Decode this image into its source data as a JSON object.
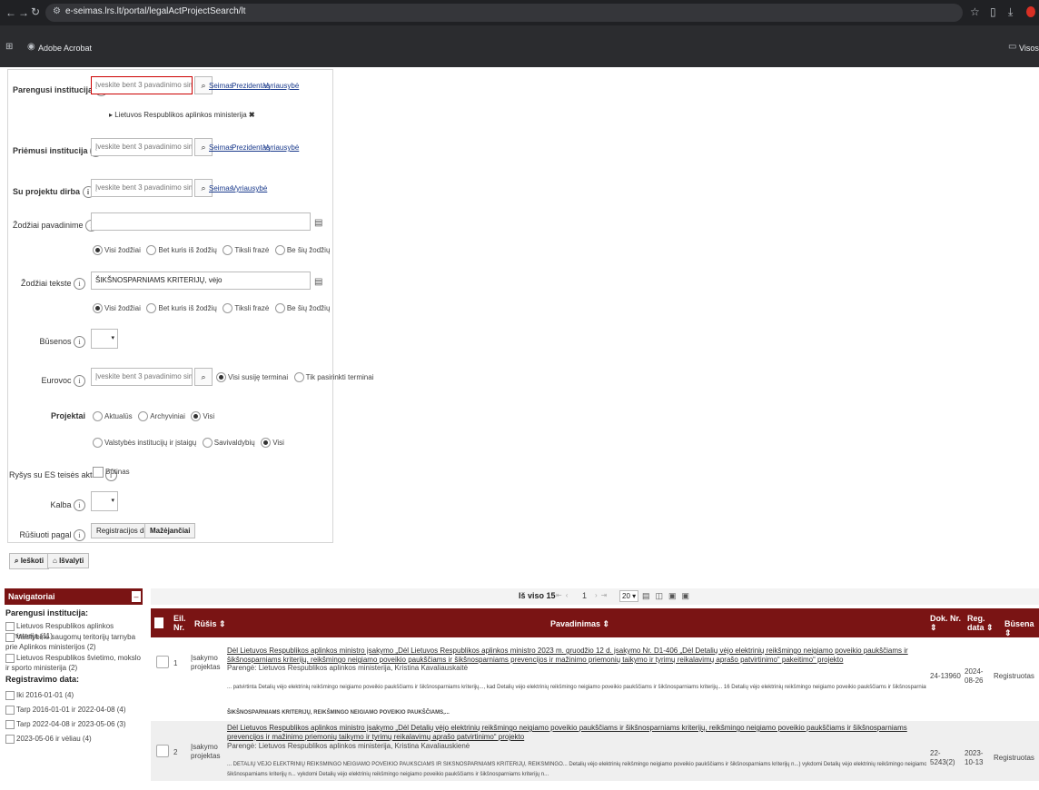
{
  "browser": {
    "url": "e-seimas.lrs.lt/portal/legalActProjectSearch/lt",
    "bookmark_acrobat": "Adobe Acrobat",
    "bookmark_other": "Visos"
  },
  "form": {
    "preparer_label": "Parengusi institucija",
    "preparer_placeholder": "Įveskite bent 3 pavadinimo simbolius",
    "preparer_selected": "Lietuvos Respublikos aplinkos ministerija",
    "links_seimas": "Seimas",
    "links_president": "Prezidentas",
    "links_government": "Vyriausybė",
    "receiver_label": "Priėmusi institucija",
    "receiver_placeholder": "Įveskite bent 3 pavadinimo simbolius",
    "worker_label": "Su projektu dirba",
    "worker_placeholder": "Įveskite bent 3 pavadinimo simbolius",
    "title_words_label": "Žodžiai pavadinime",
    "title_words_value": "",
    "text_words_label": "Žodžiai tekste",
    "text_words_value": "ŠIKŠNOSPARNIAMS KRITERIJŲ, vėjo",
    "opt_all_words": "Visi žodžiai",
    "opt_any_word": "Bet kuris iš žodžių",
    "opt_exact": "Tiksli frazė",
    "opt_without": "Be šių žodžių",
    "status_label": "Būsenos",
    "eurovoc_label": "Eurovoc",
    "eurovoc_placeholder": "Įveskite bent 3 pavadinimo simbolius",
    "eurovoc_opt_related": "Visi susiję terminai",
    "eurovoc_opt_selected": "Tik pasirinkti terminai",
    "projects_label": "Projektai",
    "opt_current": "Aktualūs",
    "opt_archive": "Archyviniai",
    "opt_all": "Visi",
    "opt_state": "Valstybės institucijų ir įstaigų",
    "opt_municipal": "Savivaldybių",
    "eu_label": "Ryšys su ES teisės aktais",
    "eu_checkbox": "Būtinas",
    "language_label": "Kalba",
    "sort_label": "Rūšiuoti pagal",
    "sort_value": "Registracijos data",
    "sort_order": "Mažėjančiai",
    "search_button": "Ieškoti",
    "clear_button": "Išvalyti"
  },
  "navigator": {
    "title": "Navigatoriai",
    "section1": "Parengusi institucija:",
    "s1_items": [
      "Lietuvos Respublikos aplinkos ministerija (11)",
      "Valstybinė saugomų teritorijų tarnyba prie Aplinkos ministerijos (2)",
      "Lietuvos Respublikos švietimo, mokslo ir sporto ministerija (2)"
    ],
    "section2": "Registravimo data:",
    "s2_items": [
      "Iki 2016-01-01 (4)",
      "Tarp 2016-01-01 ir 2022-04-08 (4)",
      "Tarp 2022-04-08 ir 2023-05-06 (3)",
      "2023-05-06 ir vėliau (4)"
    ]
  },
  "results": {
    "total_label": "Iš viso 15",
    "page": "1",
    "per_page": "20",
    "col_no": "Eil. Nr.",
    "col_type": "Rūšis ⇕",
    "col_title": "Pavadinimas ⇕",
    "col_docno": "Dok. Nr. ⇕",
    "col_regdate": "Reg. data ⇕",
    "col_status": "Būsena ⇕",
    "rows": [
      {
        "no": "1",
        "type": "Įsakymo projektas",
        "title": "Dėl Lietuvos Respublikos aplinkos ministro įsakymo „Dėl Lietuvos Respublikos aplinkos ministro 2023 m. gruodžio 12 d. įsakymo Nr. D1-406 „Dėl Detalių vėjo elektrinių reikšmingo neigiamo poveikio paukščiams ir šikšnosparniams kriterijų, reikšmingo neigiamo poveikio paukščiams ir šikšnosparniams prevencijos ir mažinimo priemonių taikymo ir tyrimų reikalavimų aprašo patvirtinimo“ pakeitimo“ projekto",
        "preparer": "Parengė: Lietuvos Respublikos aplinkos ministerija, Kristina Kavaliauskaitė",
        "snippet1": "... patvirtinta Detalių vėjo elektrinių reikšmingo neigiamo poveikio paukščiams ir šikšnosparniams kriterijų..., kad Detalių vėjo elektrinių reikšmingo neigiamo poveikio paukščiams ir šikšnosparniams kriterijų... 16 Detalių vėjo elektrinių reikšmingo neigiamo poveikio paukščiams ir šikšnosparniams kriterijų... REIKŠMINGO NEIGIAMO POVEIKIO PAUKŠČIAMS IR",
        "snippet2": "ŠIKŠNOSPARNIAMS KRITERIJŲ, REIKŠMINGO NEIGIAMO POVEIKIO PAUKŠČIAMS,...",
        "docno": "24-13960",
        "regdate": "2024-08-26",
        "status": "Registruotas"
      },
      {
        "no": "2",
        "type": "Įsakymo projektas",
        "title": "Dėl Lietuvos Respublikos aplinkos ministro įsakymo „Dėl Detalių vėjo elektrinių reikšmingo neigiamo poveikio paukščiams ir šikšnosparniams kriterijų, reikšmingo neigiamo poveikio paukščiams ir šikšnosparniams prevencijos ir mažinimo priemonių taikymo ir tyrimų reikalavimų aprašo patvirtinimo“ projekto",
        "preparer": "Parengė: Lietuvos Respublikos aplinkos ministerija, Kristina Kavaliauskienė",
        "snippet1": "... DETALIŲ VĖJO ELEKTRINIŲ REIKŠMINGO NEIGIAMO POVEIKIO PAUKŠČIAMS IR ŠIKŠNOSPARNIAMS KRITERIJŲ, REIKŠMINGO... Detalių vėjo elektrinių reikšmingo neigiamo poveikio paukščiams ir šikšnosparniams kriterijų n...) vykdomi Detalių vėjo elektrinių reikšmingo neigiamo poveikio paukščiams ir",
        "snippet2": "šikšnosparniams kriterijų n... vykdomi Detalių vėjo elektrinių reikšmingo neigiamo poveikio paukščiams ir šikšnosparniams kriterijų n...",
        "docno": "22-5243(2)",
        "regdate": "2023-10-13",
        "status": "Registruotas"
      }
    ]
  },
  "colors": {
    "header": "#7a1414",
    "chrome": "#202124"
  }
}
